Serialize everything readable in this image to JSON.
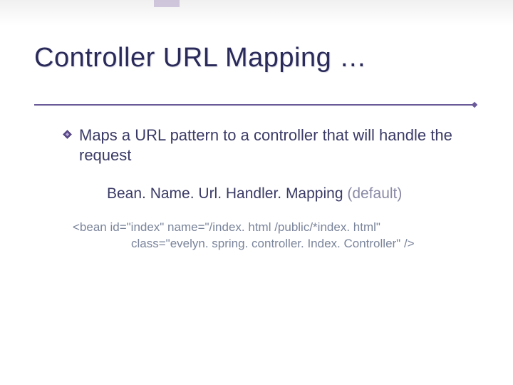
{
  "title": "Controller URL Mapping …",
  "bullet": "Maps a URL pattern to a controller that will handle the request",
  "subhead": {
    "name": "Bean. Name. Url. Handler. Mapping",
    "suffix": " (default)"
  },
  "code": {
    "l1": "<bean id=\"index\" name=\"/index. html /public/*index. html\"",
    "l2": "class=\"evelyn. spring. controller. Index. Controller\" />"
  }
}
